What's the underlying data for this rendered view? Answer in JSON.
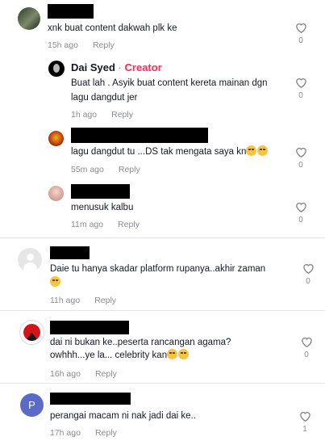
{
  "comments": [
    {
      "text": "xnk buat content dakwah plk ke",
      "time": "15h ago",
      "reply": "Reply",
      "likes": "0"
    },
    {
      "name": "Dai Syed",
      "separator": "·",
      "badge": "Creator",
      "text_line1": "Buat lah . Asyik buat content kereta mainan dgn",
      "text_line2": "lagu dangdut jer",
      "time": "1h ago",
      "reply": "Reply",
      "likes": "0"
    },
    {
      "text": "lagu dangdut tu ...DS tak mengata saya kn",
      "time": "55m ago",
      "reply": "Reply",
      "likes": "0"
    },
    {
      "text": "menusuk kalbu",
      "time": "11m ago",
      "reply": "Reply",
      "likes": "0"
    },
    {
      "text": "Daie tu hanya skadar platform rupanya..akhir zaman",
      "time": "11h ago",
      "reply": "Reply",
      "likes": "0"
    },
    {
      "text_line1": "dai ni bukan ke..peserta rancangan agama?",
      "text_line2": "owhhh...ye la... celebrity kan",
      "time": "16h ago",
      "reply": "Reply",
      "likes": "0"
    },
    {
      "avatar_letter": "P",
      "text": "perangai macam ni nak jadi dai ke..",
      "time": "17h ago",
      "reply": "Reply",
      "likes": "1"
    }
  ],
  "colors": {
    "creator": "#fe2c55",
    "meta": "#8a8b91",
    "avatar_p": "#5b6ac9"
  },
  "icons": [
    "heart-outline-icon"
  ]
}
